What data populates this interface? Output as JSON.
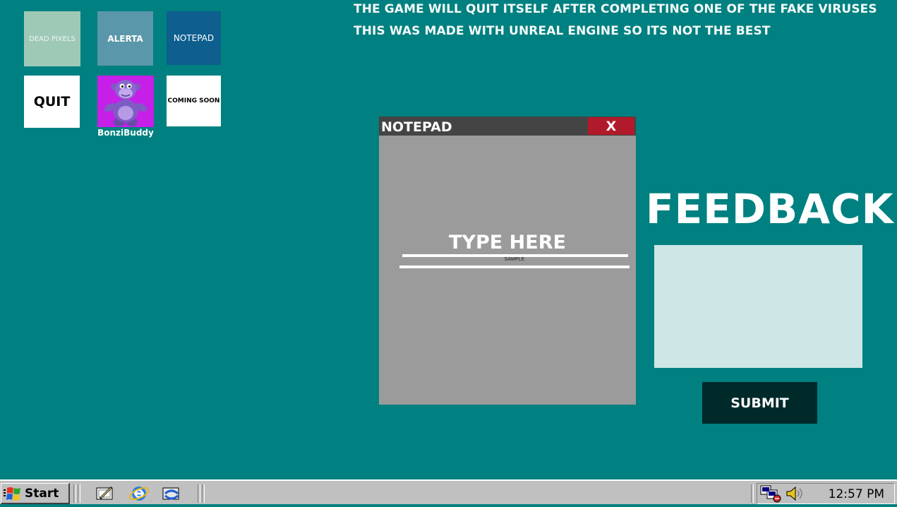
{
  "desktop": {
    "icons": [
      {
        "label": "DEAD PIXELS"
      },
      {
        "label": "ALERTA"
      },
      {
        "label": "NOTEPAD"
      },
      {
        "label": "QUIT"
      },
      {
        "label": "BonziBuddy",
        "icon": "bonzi-buddy-icon"
      },
      {
        "label": "COMING SOON"
      }
    ]
  },
  "info": {
    "line1": "THE GAME WILL QUIT ITSELF AFTER COMPLETING ONE OF THE FAKE VIRUSES",
    "line2": "THIS WAS MADE WITH UNREAL ENGINE SO ITS NOT THE BEST"
  },
  "notepad": {
    "title": "NOTEPAD",
    "close_label": "X",
    "heading": "TYPE HERE",
    "sample_text": "SAMPLE"
  },
  "feedback": {
    "title": "FEEDBACK",
    "input_value": "",
    "submit_label": "SUBMIT"
  },
  "taskbar": {
    "start_label": "Start",
    "quick_launch": [
      "show-desktop-icon",
      "internet-explorer-icon",
      "channels-icon"
    ],
    "tray_icons": [
      "network-icon",
      "volume-icon"
    ],
    "clock": "12:57 PM"
  },
  "colors": {
    "desktop_bg": "#008080",
    "notepad_bg": "#9b9b9b",
    "titlebar": "#444444",
    "close_button": "#b01a2a",
    "feedback_box": "#cde6e6",
    "submit_button": "#002a2a",
    "taskbar": "#c0c0c0"
  }
}
